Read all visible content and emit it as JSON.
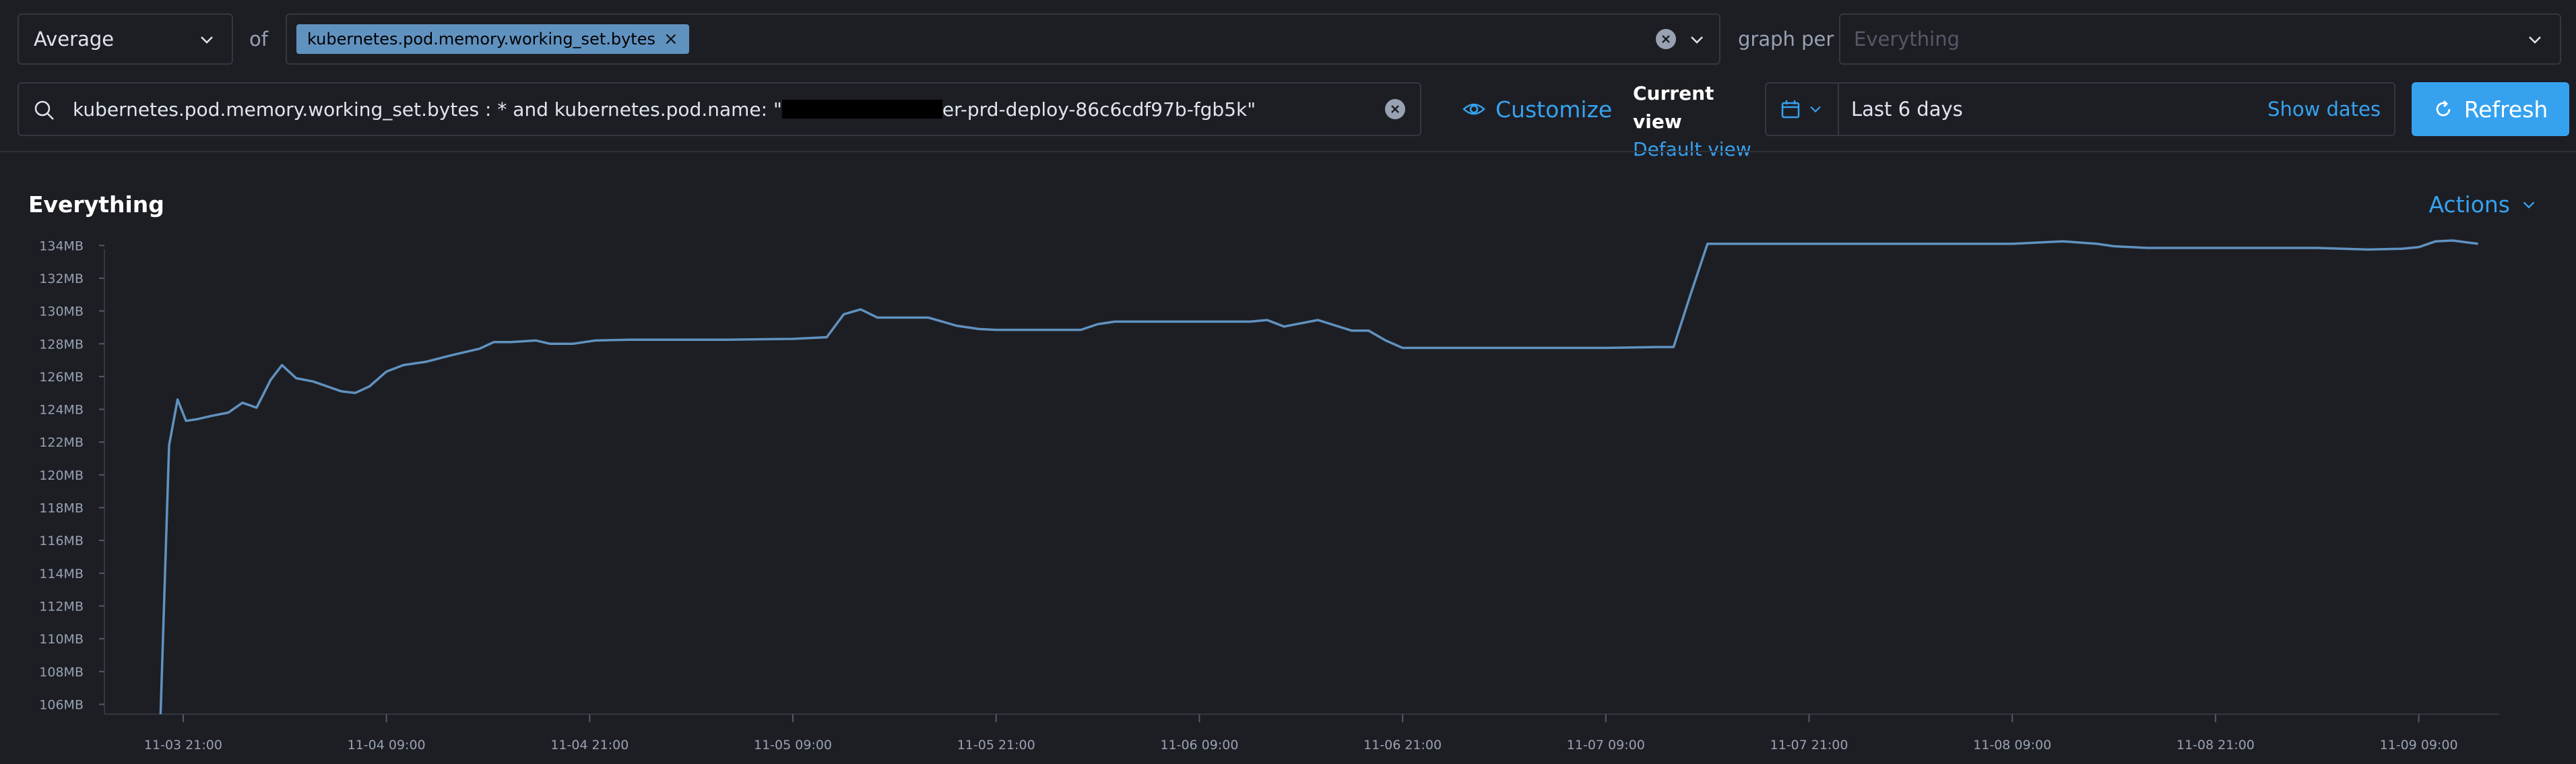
{
  "toolbar": {
    "aggregation": "Average",
    "of_label": "of",
    "metric_pill": "kubernetes.pod.memory.working_set.bytes",
    "graph_per_label": "graph per",
    "graph_per_placeholder": "Everything"
  },
  "search": {
    "query_prefix": "kubernetes.pod.memory.working_set.bytes : * and kubernetes.pod.name: \"",
    "query_suffix": "er-prd-deploy-86c6cdf97b-fgb5k\""
  },
  "view": {
    "customize_label": "Customize",
    "current_view_label": "Current view",
    "default_view_label": "Default view"
  },
  "date_picker": {
    "range": "Last 6 days",
    "show_dates": "Show dates"
  },
  "refresh_label": "Refresh",
  "panel": {
    "title": "Everything",
    "actions_label": "Actions"
  },
  "colors": {
    "accent": "#36a2ef",
    "series": "#6092c0",
    "background": "#1d1e24"
  },
  "chart_data": {
    "type": "line",
    "title": "Everything",
    "xlabel": "",
    "ylabel": "",
    "y_unit": "MB",
    "ylim": [
      105.4,
      135
    ],
    "xlim": [
      "11-03 16:40",
      "11-09 13:45"
    ],
    "grid": false,
    "y_ticks": [
      "106MB",
      "108MB",
      "110MB",
      "112MB",
      "114MB",
      "116MB",
      "118MB",
      "120MB",
      "122MB",
      "124MB",
      "126MB",
      "128MB",
      "130MB",
      "132MB",
      "134MB"
    ],
    "x_ticks": [
      "11-03 21:00",
      "11-04 09:00",
      "11-04 21:00",
      "11-05 09:00",
      "11-05 21:00",
      "11-06 09:00",
      "11-06 21:00",
      "11-07 09:00",
      "11-07 21:00",
      "11-08 09:00",
      "11-08 21:00",
      "11-09 09:00"
    ],
    "series": [
      {
        "values": [
          [
            "11-03 19:40",
            105.4
          ],
          [
            "11-03 20:10",
            121.8
          ],
          [
            "11-03 20:40",
            124.6
          ],
          [
            "11-03 21:10",
            123.3
          ],
          [
            "11-03 21:50",
            123.4
          ],
          [
            "11-03 22:40",
            123.6
          ],
          [
            "11-03 23:40",
            123.8
          ],
          [
            "11-04 00:30",
            124.4
          ],
          [
            "11-04 01:20",
            124.1
          ],
          [
            "11-04 02:10",
            125.8
          ],
          [
            "11-04 02:50",
            126.7
          ],
          [
            "11-04 03:40",
            125.9
          ],
          [
            "11-04 04:40",
            125.7
          ],
          [
            "11-04 05:30",
            125.4
          ],
          [
            "11-04 06:20",
            125.1
          ],
          [
            "11-04 07:10",
            125.0
          ],
          [
            "11-04 08:00",
            125.4
          ],
          [
            "11-04 09:00",
            126.3
          ],
          [
            "11-04 10:00",
            126.7
          ],
          [
            "11-04 11:20",
            126.9
          ],
          [
            "11-04 12:50",
            127.3
          ],
          [
            "11-04 14:30",
            127.7
          ],
          [
            "11-04 15:20",
            128.1
          ],
          [
            "11-04 16:20",
            128.1
          ],
          [
            "11-04 17:50",
            128.2
          ],
          [
            "11-04 18:40",
            128.0
          ],
          [
            "11-04 20:00",
            128.0
          ],
          [
            "11-04 21:20",
            128.2
          ],
          [
            "11-04 23:20",
            128.25
          ],
          [
            "11-05 05:00",
            128.25
          ],
          [
            "11-05 09:00",
            128.3
          ],
          [
            "11-05 11:00",
            128.4
          ],
          [
            "11-05 12:00",
            129.8
          ],
          [
            "11-05 13:00",
            130.1
          ],
          [
            "11-05 14:00",
            129.6
          ],
          [
            "11-05 15:00",
            129.6
          ],
          [
            "11-05 17:00",
            129.6
          ],
          [
            "11-05 18:40",
            129.1
          ],
          [
            "11-05 20:00",
            128.9
          ],
          [
            "11-05 21:00",
            128.85
          ],
          [
            "11-05 23:00",
            128.85
          ],
          [
            "11-06 01:00",
            128.85
          ],
          [
            "11-06 02:00",
            128.85
          ],
          [
            "11-06 03:00",
            129.2
          ],
          [
            "11-06 04:00",
            129.35
          ],
          [
            "11-06 06:00",
            129.35
          ],
          [
            "11-06 09:00",
            129.35
          ],
          [
            "11-06 12:00",
            129.35
          ],
          [
            "11-06 13:00",
            129.45
          ],
          [
            "11-06 14:00",
            129.05
          ],
          [
            "11-06 16:00",
            129.45
          ],
          [
            "11-06 18:00",
            128.8
          ],
          [
            "11-06 19:00",
            128.8
          ],
          [
            "11-06 20:00",
            128.2
          ],
          [
            "11-06 21:00",
            127.75
          ],
          [
            "11-07 00:00",
            127.75
          ],
          [
            "11-07 06:00",
            127.75
          ],
          [
            "11-07 09:00",
            127.75
          ],
          [
            "11-07 12:00",
            127.8
          ],
          [
            "11-07 13:00",
            127.8
          ],
          [
            "11-07 14:00",
            131.0
          ],
          [
            "11-07 15:00",
            134.1
          ],
          [
            "11-07 18:00",
            134.1
          ],
          [
            "11-07 21:00",
            134.1
          ],
          [
            "11-08 06:00",
            134.1
          ],
          [
            "11-08 09:00",
            134.1
          ],
          [
            "11-08 12:00",
            134.25
          ],
          [
            "11-08 14:00",
            134.1
          ],
          [
            "11-08 15:00",
            133.95
          ],
          [
            "11-08 16:00",
            133.9
          ],
          [
            "11-08 17:00",
            133.85
          ],
          [
            "11-08 19:00",
            133.85
          ],
          [
            "11-08 21:00",
            133.85
          ],
          [
            "11-09 03:00",
            133.85
          ],
          [
            "11-09 06:00",
            133.75
          ],
          [
            "11-09 08:00",
            133.8
          ],
          [
            "11-09 09:00",
            133.9
          ],
          [
            "11-09 10:00",
            134.25
          ],
          [
            "11-09 11:00",
            134.3
          ],
          [
            "11-09 12:30",
            134.1
          ]
        ]
      }
    ]
  }
}
